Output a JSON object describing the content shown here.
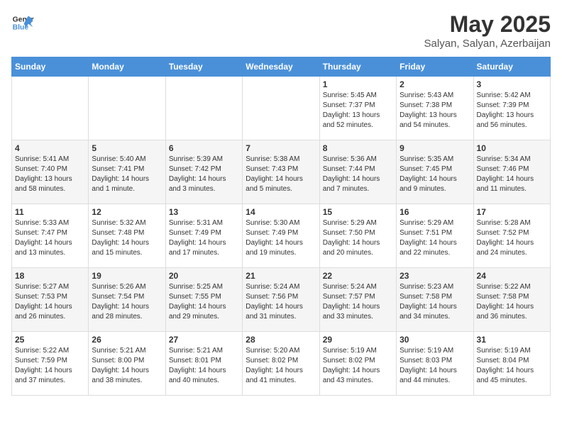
{
  "header": {
    "logo_line1": "General",
    "logo_line2": "Blue",
    "month": "May 2025",
    "location": "Salyan, Salyan, Azerbaijan"
  },
  "weekdays": [
    "Sunday",
    "Monday",
    "Tuesday",
    "Wednesday",
    "Thursday",
    "Friday",
    "Saturday"
  ],
  "weeks": [
    [
      {
        "day": "",
        "content": ""
      },
      {
        "day": "",
        "content": ""
      },
      {
        "day": "",
        "content": ""
      },
      {
        "day": "",
        "content": ""
      },
      {
        "day": "1",
        "content": "Sunrise: 5:45 AM\nSunset: 7:37 PM\nDaylight: 13 hours and 52 minutes."
      },
      {
        "day": "2",
        "content": "Sunrise: 5:43 AM\nSunset: 7:38 PM\nDaylight: 13 hours and 54 minutes."
      },
      {
        "day": "3",
        "content": "Sunrise: 5:42 AM\nSunset: 7:39 PM\nDaylight: 13 hours and 56 minutes."
      }
    ],
    [
      {
        "day": "4",
        "content": "Sunrise: 5:41 AM\nSunset: 7:40 PM\nDaylight: 13 hours and 58 minutes."
      },
      {
        "day": "5",
        "content": "Sunrise: 5:40 AM\nSunset: 7:41 PM\nDaylight: 14 hours and 1 minute."
      },
      {
        "day": "6",
        "content": "Sunrise: 5:39 AM\nSunset: 7:42 PM\nDaylight: 14 hours and 3 minutes."
      },
      {
        "day": "7",
        "content": "Sunrise: 5:38 AM\nSunset: 7:43 PM\nDaylight: 14 hours and 5 minutes."
      },
      {
        "day": "8",
        "content": "Sunrise: 5:36 AM\nSunset: 7:44 PM\nDaylight: 14 hours and 7 minutes."
      },
      {
        "day": "9",
        "content": "Sunrise: 5:35 AM\nSunset: 7:45 PM\nDaylight: 14 hours and 9 minutes."
      },
      {
        "day": "10",
        "content": "Sunrise: 5:34 AM\nSunset: 7:46 PM\nDaylight: 14 hours and 11 minutes."
      }
    ],
    [
      {
        "day": "11",
        "content": "Sunrise: 5:33 AM\nSunset: 7:47 PM\nDaylight: 14 hours and 13 minutes."
      },
      {
        "day": "12",
        "content": "Sunrise: 5:32 AM\nSunset: 7:48 PM\nDaylight: 14 hours and 15 minutes."
      },
      {
        "day": "13",
        "content": "Sunrise: 5:31 AM\nSunset: 7:49 PM\nDaylight: 14 hours and 17 minutes."
      },
      {
        "day": "14",
        "content": "Sunrise: 5:30 AM\nSunset: 7:49 PM\nDaylight: 14 hours and 19 minutes."
      },
      {
        "day": "15",
        "content": "Sunrise: 5:29 AM\nSunset: 7:50 PM\nDaylight: 14 hours and 20 minutes."
      },
      {
        "day": "16",
        "content": "Sunrise: 5:29 AM\nSunset: 7:51 PM\nDaylight: 14 hours and 22 minutes."
      },
      {
        "day": "17",
        "content": "Sunrise: 5:28 AM\nSunset: 7:52 PM\nDaylight: 14 hours and 24 minutes."
      }
    ],
    [
      {
        "day": "18",
        "content": "Sunrise: 5:27 AM\nSunset: 7:53 PM\nDaylight: 14 hours and 26 minutes."
      },
      {
        "day": "19",
        "content": "Sunrise: 5:26 AM\nSunset: 7:54 PM\nDaylight: 14 hours and 28 minutes."
      },
      {
        "day": "20",
        "content": "Sunrise: 5:25 AM\nSunset: 7:55 PM\nDaylight: 14 hours and 29 minutes."
      },
      {
        "day": "21",
        "content": "Sunrise: 5:24 AM\nSunset: 7:56 PM\nDaylight: 14 hours and 31 minutes."
      },
      {
        "day": "22",
        "content": "Sunrise: 5:24 AM\nSunset: 7:57 PM\nDaylight: 14 hours and 33 minutes."
      },
      {
        "day": "23",
        "content": "Sunrise: 5:23 AM\nSunset: 7:58 PM\nDaylight: 14 hours and 34 minutes."
      },
      {
        "day": "24",
        "content": "Sunrise: 5:22 AM\nSunset: 7:58 PM\nDaylight: 14 hours and 36 minutes."
      }
    ],
    [
      {
        "day": "25",
        "content": "Sunrise: 5:22 AM\nSunset: 7:59 PM\nDaylight: 14 hours and 37 minutes."
      },
      {
        "day": "26",
        "content": "Sunrise: 5:21 AM\nSunset: 8:00 PM\nDaylight: 14 hours and 38 minutes."
      },
      {
        "day": "27",
        "content": "Sunrise: 5:21 AM\nSunset: 8:01 PM\nDaylight: 14 hours and 40 minutes."
      },
      {
        "day": "28",
        "content": "Sunrise: 5:20 AM\nSunset: 8:02 PM\nDaylight: 14 hours and 41 minutes."
      },
      {
        "day": "29",
        "content": "Sunrise: 5:19 AM\nSunset: 8:02 PM\nDaylight: 14 hours and 43 minutes."
      },
      {
        "day": "30",
        "content": "Sunrise: 5:19 AM\nSunset: 8:03 PM\nDaylight: 14 hours and 44 minutes."
      },
      {
        "day": "31",
        "content": "Sunrise: 5:19 AM\nSunset: 8:04 PM\nDaylight: 14 hours and 45 minutes."
      }
    ]
  ]
}
